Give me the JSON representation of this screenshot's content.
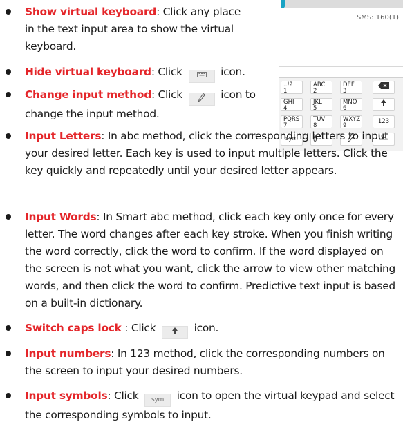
{
  "items": [
    {
      "term": "Show virtual keyboard",
      "sep": ":",
      "text": " Click any place in the text input area to show the virtual keyboard."
    },
    {
      "term": "Hide virtual keyboard",
      "sep": ":",
      "before": " Click",
      "icon": "keyboard-icon",
      "after": "icon."
    },
    {
      "term": "Change input method",
      "sep": ":",
      "before": " Click",
      "icon": "pencil-icon",
      "after": "icon to change the input method."
    },
    {
      "term": "Input Letters",
      "sep": ":",
      "text": " In abc method, click the corresponding letters to input your desired letter. Each key is used to input multiple letters. Click the key quickly and repeatedly until your desired letter appears."
    },
    {
      "term": "Input Words",
      "sep": ":",
      "text": " In Smart abc method, click each key only once for every letter. The word changes after each key stroke. When you finish writing the word correctly, click the word to confirm. If the word displayed on the screen is not what you want, click the arrow to view other matching words, and then click the word to confirm. Predictive text input is based on a built-in dictionary."
    },
    {
      "term": "Switch caps lock",
      "sep": " :",
      "before": " Click",
      "icon": "arrow-up-icon",
      "after": "icon."
    },
    {
      "term": "Input numbers",
      "sep": ":",
      "text": " In 123 method, click the corresponding numbers on the screen to input your desired numbers."
    },
    {
      "term": "Input symbols",
      "sep": ":",
      "before": " Click",
      "icon": "sym-icon",
      "icon_text": "sym",
      "after": "icon to open the virtual keypad and select the corresponding symbols to input."
    }
  ],
  "phone": {
    "sms_count": "SMS: 160(1)",
    "keys": [
      [
        "..!?",
        "1"
      ],
      [
        "ABC",
        "2"
      ],
      [
        "DEF",
        "3"
      ],
      [
        "backspace-icon"
      ],
      [
        "GHI",
        "4"
      ],
      [
        "JKL",
        "5"
      ],
      [
        "MNO",
        "6"
      ],
      [
        "arrow-up-icon"
      ],
      [
        "PQRS",
        "7"
      ],
      [
        "TUV",
        "8"
      ],
      [
        "WXYZ",
        "9"
      ],
      [
        "123"
      ],
      [
        "sym"
      ],
      [
        "space-icon",
        "0"
      ],
      [
        "pencil-icon"
      ],
      [
        "keyboard-icon"
      ]
    ]
  }
}
